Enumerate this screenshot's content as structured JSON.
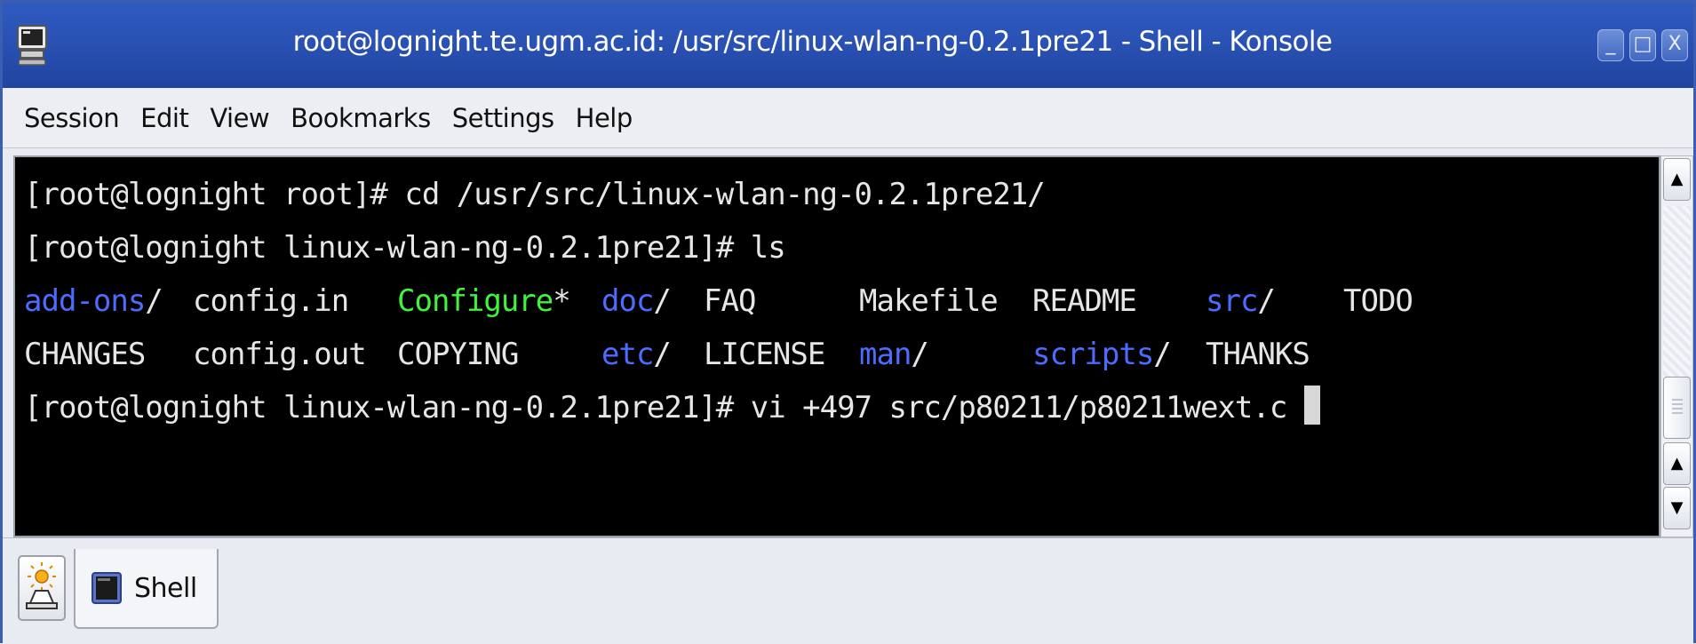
{
  "window": {
    "title": "root@lognight.te.ugm.ac.id: /usr/src/linux-wlan-ng-0.2.1pre21 - Shell - Konsole",
    "controls": {
      "minimize": "_",
      "maximize": "□",
      "close": "X"
    }
  },
  "menubar": {
    "items": [
      "Session",
      "Edit",
      "View",
      "Bookmarks",
      "Settings",
      "Help"
    ]
  },
  "terminal": {
    "line1": {
      "prompt": "[root@lognight root]# ",
      "command": "cd /usr/src/linux-wlan-ng-0.2.1pre21/"
    },
    "line2": {
      "prompt": "[root@lognight linux-wlan-ng-0.2.1pre21]# ",
      "command": "ls"
    },
    "ls_row1": [
      {
        "name": "add-ons",
        "suffix": "/",
        "kind": "dir"
      },
      {
        "name": "config.in",
        "suffix": "",
        "kind": "file"
      },
      {
        "name": "Configure",
        "suffix": "*",
        "kind": "exec"
      },
      {
        "name": "doc",
        "suffix": "/",
        "kind": "dir"
      },
      {
        "name": "FAQ",
        "suffix": "",
        "kind": "file"
      },
      {
        "name": "Makefile",
        "suffix": "",
        "kind": "file"
      },
      {
        "name": "README",
        "suffix": "",
        "kind": "file"
      },
      {
        "name": "src",
        "suffix": "/",
        "kind": "dir"
      },
      {
        "name": "TODO",
        "suffix": "",
        "kind": "file"
      }
    ],
    "ls_row2": [
      {
        "name": "CHANGES",
        "suffix": "",
        "kind": "file"
      },
      {
        "name": "config.out",
        "suffix": "",
        "kind": "file"
      },
      {
        "name": "COPYING",
        "suffix": "",
        "kind": "file"
      },
      {
        "name": "etc",
        "suffix": "/",
        "kind": "dir"
      },
      {
        "name": "LICENSE",
        "suffix": "",
        "kind": "file"
      },
      {
        "name": "man",
        "suffix": "/",
        "kind": "dir"
      },
      {
        "name": "scripts",
        "suffix": "/",
        "kind": "dir"
      },
      {
        "name": "THANKS",
        "suffix": "",
        "kind": "file"
      }
    ],
    "line5": {
      "prompt": "[root@lognight linux-wlan-ng-0.2.1pre21]# ",
      "command": "vi +497 src/p80211/p80211wext.c "
    },
    "colors": {
      "background": "#000000",
      "text": "#e6e6e6",
      "directory": "#4c6cff",
      "executable": "#3df53d"
    }
  },
  "scrollbar": {
    "up_arrow": "▲",
    "down_arrow": "▼"
  },
  "tabs": [
    {
      "label": "Shell",
      "icon": "terminal-icon",
      "active": true
    }
  ],
  "new_session_icon": "new-session-icon"
}
